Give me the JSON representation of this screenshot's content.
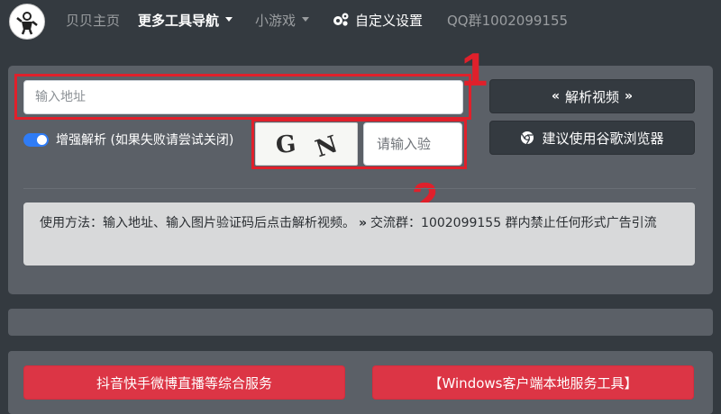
{
  "navbar": {
    "home": "贝贝主页",
    "tools_nav": "更多工具导航",
    "games": "小游戏",
    "settings": "自定义设置",
    "qq_group": "QQ群1002099155"
  },
  "parser": {
    "url_placeholder": "输入地址",
    "parse_button": "解析视频",
    "browser_button": "建议使用谷歌浏览器",
    "enhanced_toggle_label": "增强解析 (如果失败请尝试关闭)",
    "enhanced_on": true,
    "captcha_text": [
      "G",
      "N"
    ],
    "captcha_placeholder": "请输入验"
  },
  "annotations": {
    "label_1": "1",
    "label_2": "2",
    "color": "#e0202b"
  },
  "info": {
    "usage": "使用方法：输入地址、输入图片验证码后点击解析视频。",
    "separator": "»",
    "group_notice": "交流群：1002099155 群内禁止任何形式广告引流"
  },
  "services": {
    "left_button": "抖音快手微博直播等综合服务",
    "right_button": "【Windows客户端本地服务工具】"
  },
  "colors": {
    "background": "#343a40",
    "panel": "#5b6067",
    "accent_blue": "#2f7cf6",
    "danger": "#dc3545"
  }
}
